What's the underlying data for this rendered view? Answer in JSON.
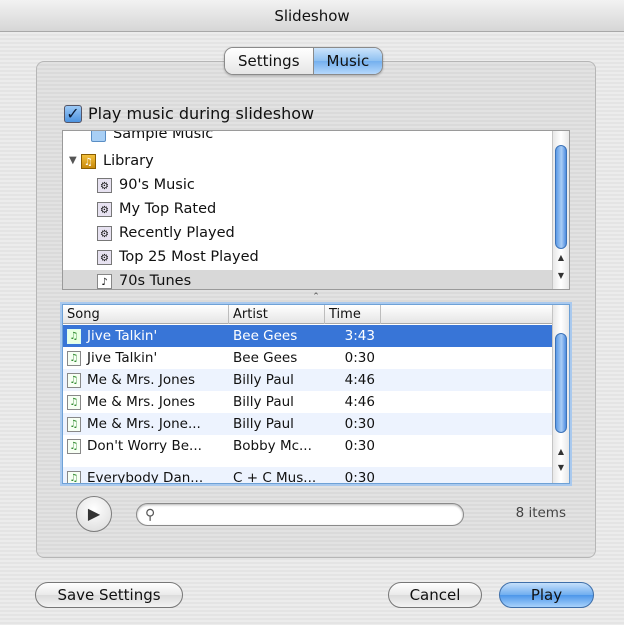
{
  "window": {
    "title": "Slideshow"
  },
  "tabs": [
    {
      "label": "Settings",
      "active": false
    },
    {
      "label": "Music",
      "active": true
    }
  ],
  "play_music": {
    "label": "Play music during slideshow",
    "checked": true
  },
  "sources": [
    {
      "label": "Sample Music",
      "icon": "folder-icon",
      "selected": false
    },
    {
      "label": "Library",
      "icon": "library-icon",
      "selected": false,
      "expanded": true
    },
    {
      "label": "90's Music",
      "icon": "smart-playlist-icon",
      "selected": false
    },
    {
      "label": "My Top Rated",
      "icon": "smart-playlist-icon",
      "selected": false
    },
    {
      "label": "Recently Played",
      "icon": "smart-playlist-icon",
      "selected": false
    },
    {
      "label": "Top 25 Most Played",
      "icon": "smart-playlist-icon",
      "selected": false
    },
    {
      "label": "70s Tunes",
      "icon": "playlist-icon",
      "selected": true
    }
  ],
  "songs_table": {
    "columns": [
      "Song",
      "Artist",
      "Time"
    ],
    "rows": [
      {
        "song": "Jive Talkin'",
        "artist": "Bee Gees",
        "time": "3:43",
        "selected": true
      },
      {
        "song": "Jive Talkin'",
        "artist": "Bee Gees",
        "time": "0:30",
        "selected": false
      },
      {
        "song": "Me & Mrs. Jones",
        "artist": "Billy Paul",
        "time": "4:46",
        "selected": false
      },
      {
        "song": "Me & Mrs. Jones",
        "artist": "Billy Paul",
        "time": "4:46",
        "selected": false
      },
      {
        "song": "Me & Mrs. Jone...",
        "artist": "Billy Paul",
        "time": "0:30",
        "selected": false
      },
      {
        "song": "Don't Worry Be...",
        "artist": "Bobby Mc...",
        "time": "0:30",
        "selected": false
      },
      {
        "song": "Everybody Dan...",
        "artist": "C + C Mus...",
        "time": "0:30",
        "selected": false
      }
    ]
  },
  "search": {
    "value": "",
    "placeholder": ""
  },
  "item_count": "8 items",
  "buttons": {
    "save": "Save Settings",
    "cancel": "Cancel",
    "play": "Play"
  },
  "colors": {
    "selection": "#3875d7",
    "accent": "#4d97ea"
  }
}
